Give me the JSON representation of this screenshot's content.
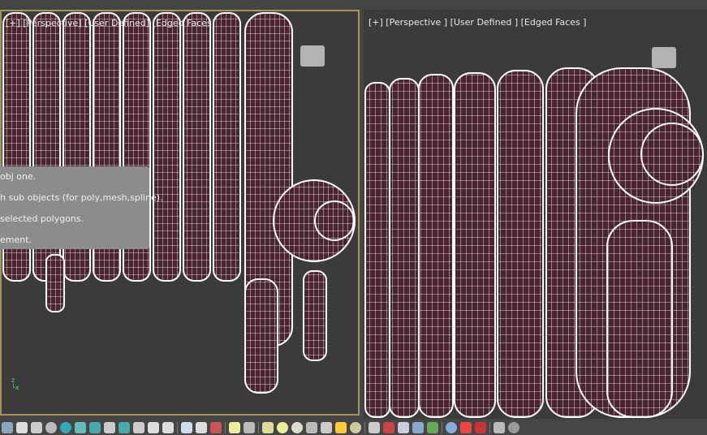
{
  "viewports": {
    "left": {
      "label": "[+] [Perspective] [User Defined] [Edged Faces]",
      "active": true
    },
    "right": {
      "label": "[+] [Perspective ] [User Defined ] [Edged Faces ]",
      "active": false
    }
  },
  "tooltip": {
    "lines": [
      "obj one.",
      "h sub objects (for poly,mesh,spline).",
      "selected polygons.",
      "ement."
    ]
  },
  "colors": {
    "mesh_fill": "#4a2530",
    "wire": "#ffffff",
    "active_border": "#a3965a",
    "viewport_bg": "#3b3b3b"
  },
  "toolbar": {
    "icons": [
      "list-icon",
      "cone-icon",
      "tree-icon",
      "torus-icon",
      "sphere-teal-icon",
      "grid-icon",
      "select-icon",
      "camera-icon",
      "box-icon",
      "teapot-outline-icon",
      "spiral-icon",
      "lightbulb-icon",
      "separator",
      "teapot-icon",
      "cloud-icon",
      "render-icon",
      "separator",
      "light-icon",
      "film-camera-icon",
      "separator",
      "plane-icon",
      "sphere-icon",
      "sphere-outline-icon",
      "cup-icon",
      "cone-gray-icon",
      "sun-icon",
      "egg-icon",
      "separator",
      "checker-icon",
      "molecule-icon",
      "tower-icon",
      "crystal-icon",
      "plant-icon",
      "separator",
      "globe-icon",
      "palette-icon",
      "color-swatch-icon",
      "separator",
      "bottle-icon",
      "help-icon"
    ]
  }
}
